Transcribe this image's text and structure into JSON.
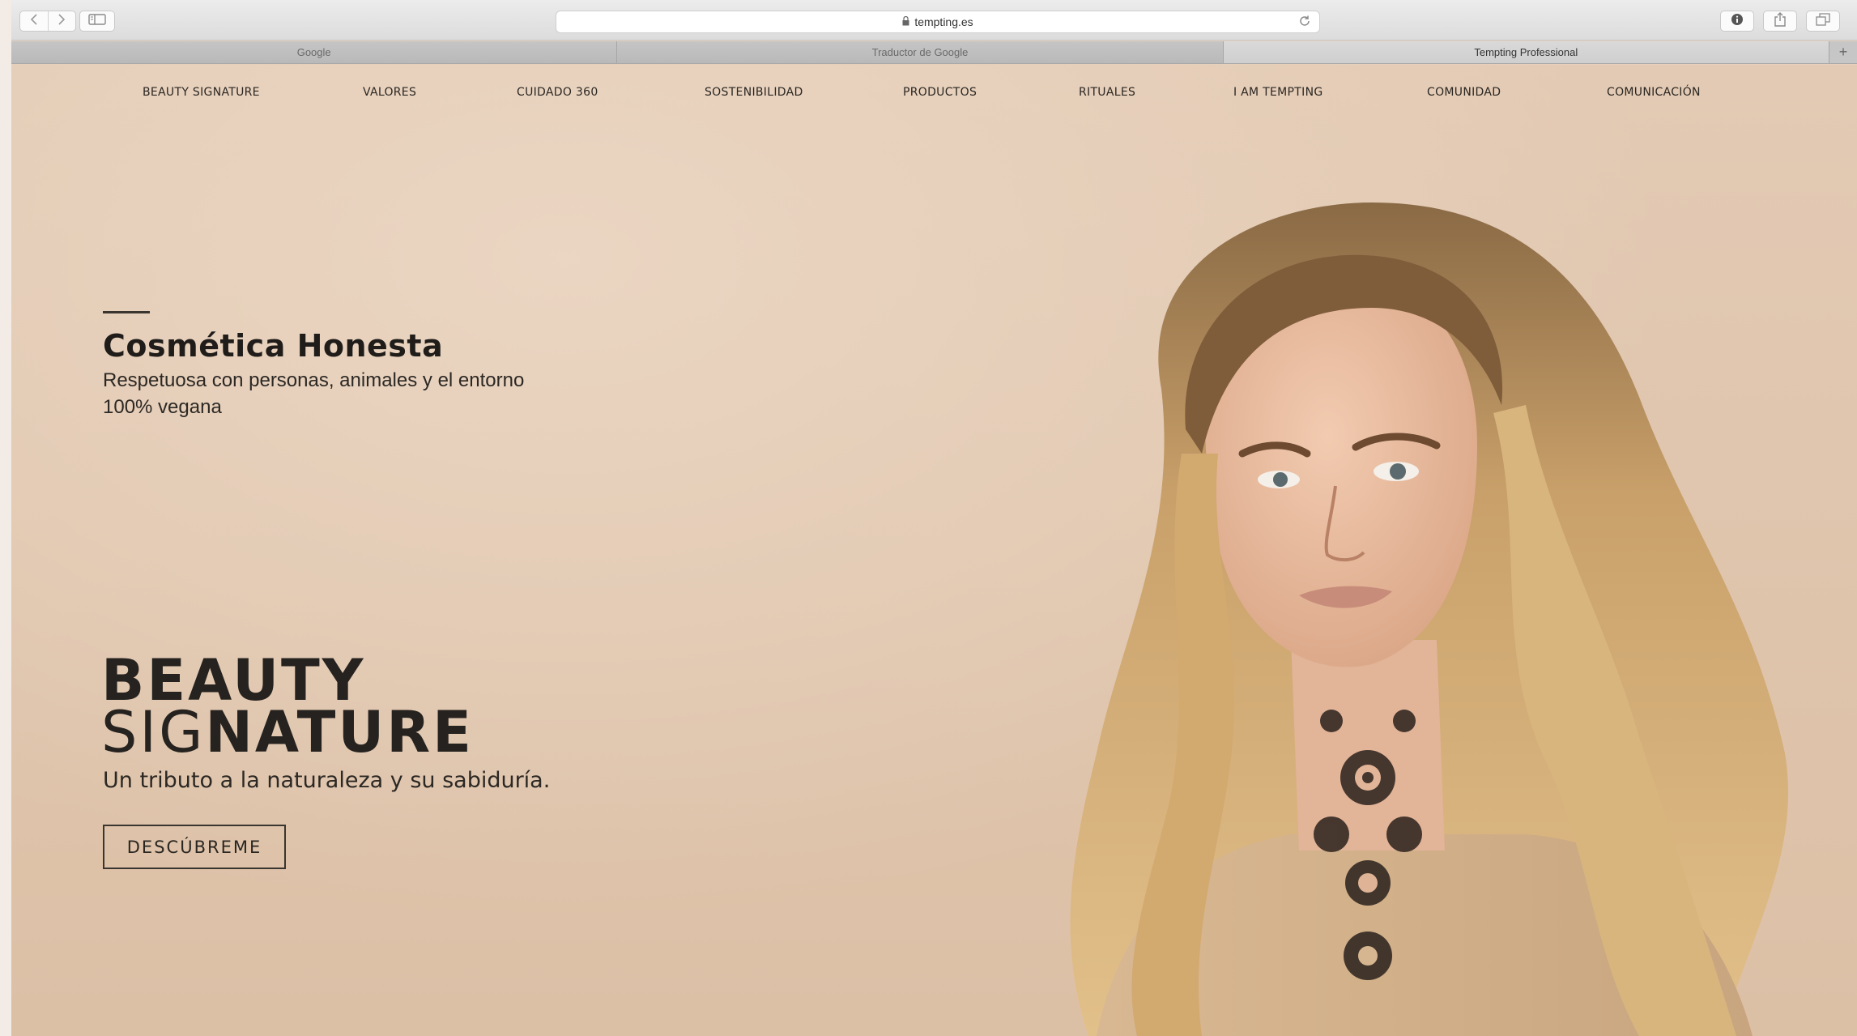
{
  "browser": {
    "url": "tempting.es",
    "tabs": [
      {
        "label": "Google",
        "active": false
      },
      {
        "label": "Traductor de Google",
        "active": false
      },
      {
        "label": "Tempting Professional",
        "active": true
      }
    ],
    "new_tab_symbol": "+"
  },
  "nav": {
    "items": [
      "BEAUTY SIGNATURE",
      "VALORES",
      "CUIDADO 360",
      "SOSTENIBILIDAD",
      "PRODUCTOS",
      "RITUALES",
      "I AM TEMPTING",
      "COMUNIDAD",
      "COMUNICACIÓN"
    ]
  },
  "hero": {
    "title": "Cosmética Honesta",
    "subtitle_1": "Respetuosa con personas, animales y el entorno",
    "subtitle_2": "100% vegana",
    "brand_line1": "BEAUTY",
    "brand_line2_thin": "SIG",
    "brand_line2_bold": "NATURE",
    "tagline": "Un tributo a la naturaleza y su sabiduría.",
    "cta_label": "DESCÚBREME"
  },
  "colors": {
    "page_background": "#e0c6ae",
    "text_dark": "#25221f",
    "hair": "#d6ae73"
  },
  "icons": [
    "back-icon",
    "forward-icon",
    "sidebar-icon",
    "lock-icon",
    "reload-icon",
    "info-icon",
    "share-icon",
    "tabs-overview-icon"
  ]
}
